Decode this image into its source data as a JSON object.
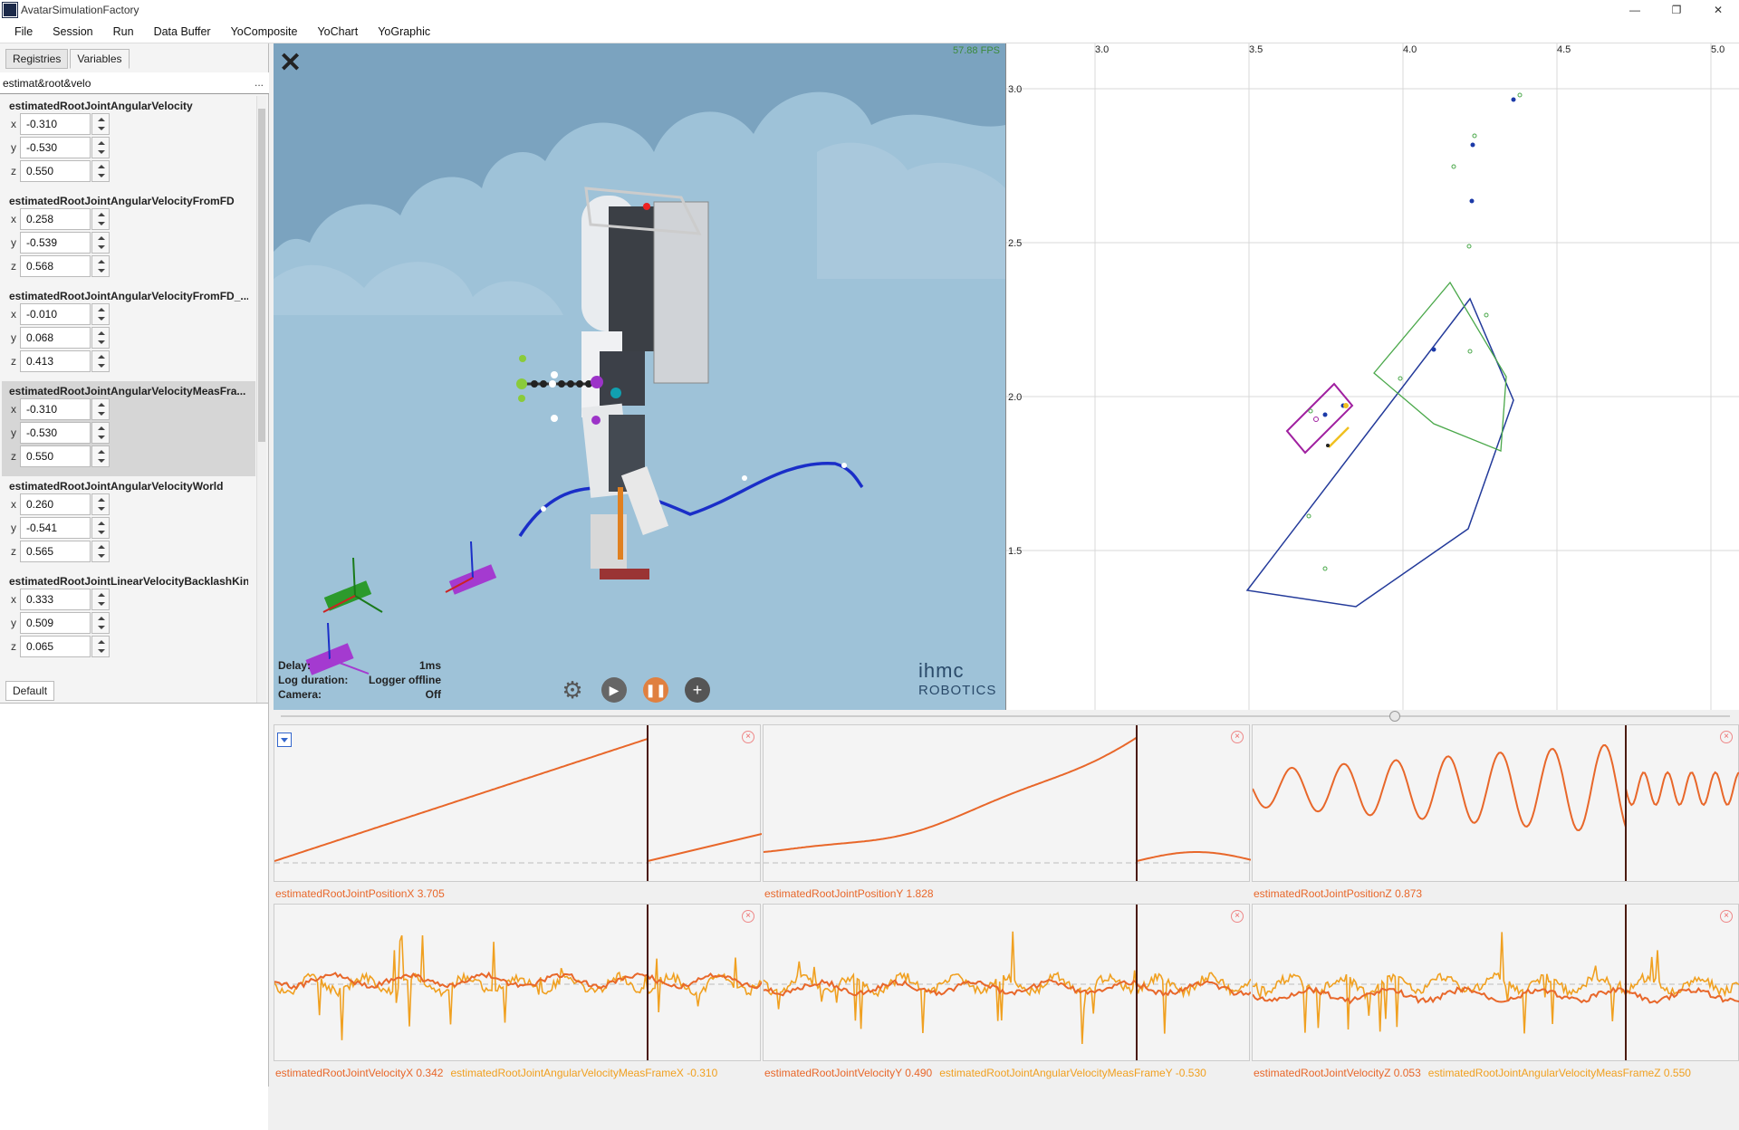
{
  "window": {
    "title": "AvatarSimulationFactory",
    "controls": [
      "—",
      "❐",
      "✕"
    ]
  },
  "menu": [
    "File",
    "Session",
    "Run",
    "Data Buffer",
    "YoComposite",
    "YoChart",
    "YoGraphic"
  ],
  "left": {
    "tabs": [
      "Registries",
      "Variables"
    ],
    "search": "estimat&root&velo",
    "more": "...",
    "groups": [
      {
        "name": "estimatedRootJointAngularVelocity",
        "x": "-0.310",
        "y": "-0.530",
        "z": "0.550"
      },
      {
        "name": "estimatedRootJointAngularVelocityFromFD",
        "x": "0.258",
        "y": "-0.539",
        "z": "0.568"
      },
      {
        "name": "estimatedRootJointAngularVelocityFromFD_...",
        "x": "-0.010",
        "y": "0.068",
        "z": "0.413"
      },
      {
        "name": "estimatedRootJointAngularVelocityMeasFra...",
        "x": "-0.310",
        "y": "-0.530",
        "z": "0.550"
      },
      {
        "name": "estimatedRootJointAngularVelocityWorld",
        "x": "0.260",
        "y": "-0.541",
        "z": "0.565"
      },
      {
        "name": "estimatedRootJointLinearVelocityBacklashKin",
        "x": "0.333",
        "y": "0.509",
        "z": "0.065"
      }
    ],
    "axis_labels": [
      "x",
      "y",
      "z"
    ],
    "bottom_tab": "Default"
  },
  "view3d": {
    "fps": "57.88 FPS",
    "close": "✕",
    "info": [
      {
        "label": "Delay:",
        "value": "1ms"
      },
      {
        "label": "Log duration:",
        "value": "Logger offline"
      },
      {
        "label": "Camera:",
        "value": "Off"
      }
    ],
    "logo_line1": "ihmc",
    "logo_line2": "ROBOTICS"
  },
  "plot2d": {
    "x_ticks": [
      "3.0",
      "3.5",
      "4.0",
      "4.5",
      "5.0"
    ],
    "y_ticks": [
      "3.0",
      "2.5",
      "2.0",
      "1.5"
    ]
  },
  "graphs": [
    {
      "labels": [
        {
          "text": "estimatedRootJointPositionX 3.705",
          "color": "#e8672a"
        }
      ]
    },
    {
      "labels": [
        {
          "text": "estimatedRootJointPositionY 1.828",
          "color": "#e8672a"
        }
      ]
    },
    {
      "labels": [
        {
          "text": "estimatedRootJointPositionZ 0.873",
          "color": "#e8672a"
        }
      ]
    },
    {
      "labels": [
        {
          "text": "estimatedRootJointVelocityX 0.342",
          "color": "#e8672a"
        },
        {
          "text": "estimatedRootJointAngularVelocityMeasFrameX -0.310",
          "color": "#f0a020"
        }
      ]
    },
    {
      "labels": [
        {
          "text": "estimatedRootJointVelocityY 0.490",
          "color": "#e8672a"
        },
        {
          "text": "estimatedRootJointAngularVelocityMeasFrameY -0.530",
          "color": "#f0a020"
        }
      ]
    },
    {
      "labels": [
        {
          "text": "estimatedRootJointVelocityZ 0.053",
          "color": "#e8672a"
        },
        {
          "text": "estimatedRootJointAngularVelocityMeasFrameZ 0.550",
          "color": "#f0a020"
        }
      ]
    }
  ],
  "colors": {
    "orange": "#e8672a",
    "yellow": "#f0a020",
    "cursor": "#4a1a10"
  }
}
